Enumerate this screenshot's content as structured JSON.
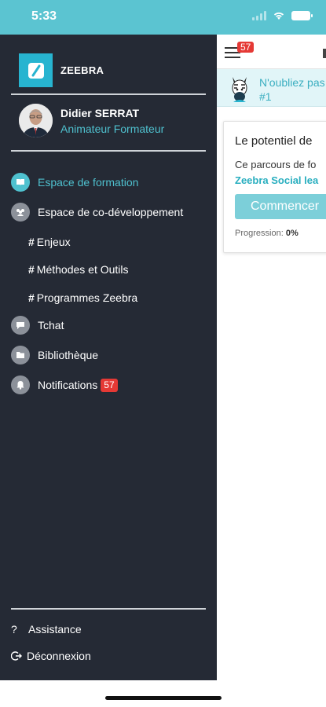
{
  "status": {
    "time": "5:33"
  },
  "brand": {
    "name": "ZEEBRA"
  },
  "user": {
    "name": "Didier SERRAT",
    "role": "Animateur Formateur"
  },
  "menu": {
    "items": [
      {
        "label": "Espace de formation",
        "icon": "book-icon"
      },
      {
        "label": "Espace de co-développement",
        "icon": "users-icon"
      },
      {
        "label": "Tchat",
        "icon": "chat-icon"
      },
      {
        "label": "Bibliothèque",
        "icon": "folder-icon"
      },
      {
        "label": "Notifications",
        "icon": "bell-icon",
        "badge": "57"
      }
    ],
    "subitems": [
      "Enjeux",
      "Méthodes et Outils",
      "Programmes Zeebra"
    ]
  },
  "bottom": {
    "assist": "Assistance",
    "logout": "Déconnexion",
    "assist_icon": "?"
  },
  "topbar": {
    "badge": "57"
  },
  "notice": {
    "line1": "N'oubliez pas",
    "line2": "#1"
  },
  "card": {
    "title": "Le potentiel de",
    "desc": "Ce parcours de fo",
    "link": "Zeebra Social lea",
    "button": "Commencer",
    "progress_label": "Progression:",
    "progress_value": "0%"
  },
  "colors": {
    "accent": "#4fc1cf",
    "sidebar": "#252a35",
    "badge": "#e53935"
  }
}
